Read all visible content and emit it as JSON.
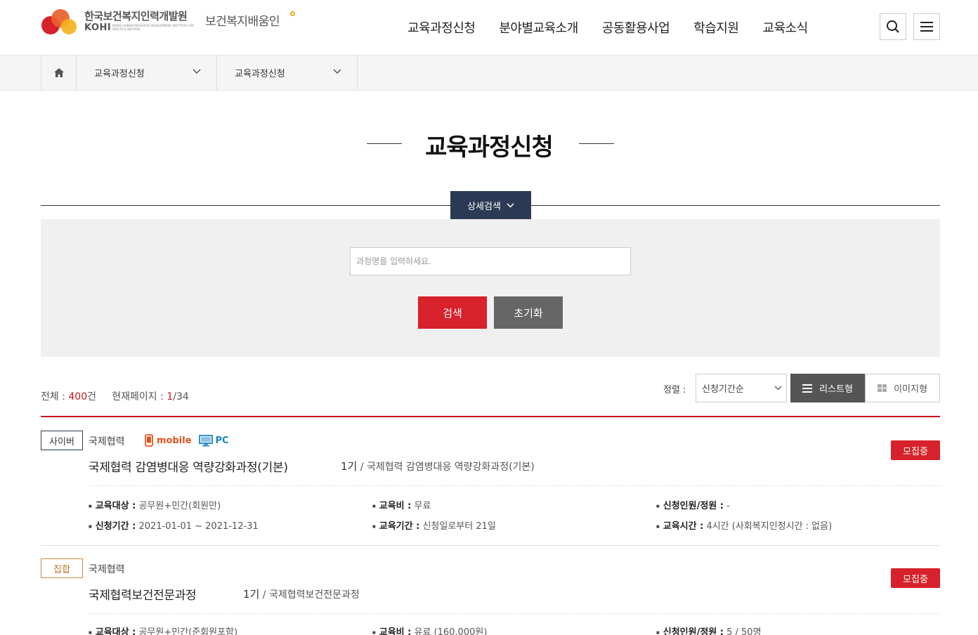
{
  "header": {
    "logo_name_ko": "한국보건복지인력개발원",
    "logo_name_en": "KOHI",
    "logo_name_en_sub": "KOREA HUMAN RESOURCE DEVELOPMENT INSTITUTE FOR HEALTH & WELFARE",
    "site_name": "보건복지배움인",
    "nav": [
      "교육과정신청",
      "분야별교육소개",
      "공동활용사업",
      "학습지원",
      "교육소식"
    ]
  },
  "breadcrumb": {
    "level1": "교육과정신청",
    "level2": "교육과정신청"
  },
  "page_title": "교육과정신청",
  "search": {
    "toggle_label": "상세검색",
    "placeholder": "과정명을 입력하세요.",
    "search_button": "검색",
    "reset_button": "초기화"
  },
  "summary": {
    "total_label": "전체 :",
    "total_count": "400",
    "total_unit": "건",
    "page_label": "현재페이지 :",
    "current_page": "1",
    "total_pages": "/34"
  },
  "sort": {
    "label": "정렬 :",
    "selected": "신청기간순",
    "list_view": "리스트형",
    "image_view": "이미지형"
  },
  "courses": [
    {
      "type": "사이버",
      "category": "국제협력",
      "devices": [
        "mobile",
        "PC"
      ],
      "status": "모집중",
      "title": "국제협력 감염병대응 역량강화과정(기본)",
      "generation": "1기",
      "subtitle": "국제협력 감염병대응 역량강화과정(기본)",
      "target_label": "교육대상 :",
      "target": "공무원+민간(회원만)",
      "fee_label": "교육비 :",
      "fee": "무료",
      "capacity_label": "신청인원/정원 :",
      "capacity": "-",
      "apply_period_label": "신청기간 :",
      "apply_period": "2021-01-01 ~ 2021-12-31",
      "edu_period_label": "교육기간 :",
      "edu_period": "신청일로부터 21일",
      "edu_hours_label": "교육시간 :",
      "edu_hours": "4시간 (사회복지인정시간 : 없음)"
    },
    {
      "type": "집합",
      "category": "국제협력",
      "status": "모집중",
      "title": "국제협력보건전문과정",
      "generation": "1기",
      "subtitle": "국제협력보건전문과정",
      "target_label": "교육대상 :",
      "target": "공무원+민간(준회원포함)",
      "fee_label": "교육비 :",
      "fee": "유료 (160,000원)",
      "capacity_label": "신청인원/정원 :",
      "capacity": "5 / 50명"
    }
  ],
  "colors": {
    "accent_red": "#d7212b",
    "navy": "#2c3b55",
    "gray_button": "#666666"
  }
}
